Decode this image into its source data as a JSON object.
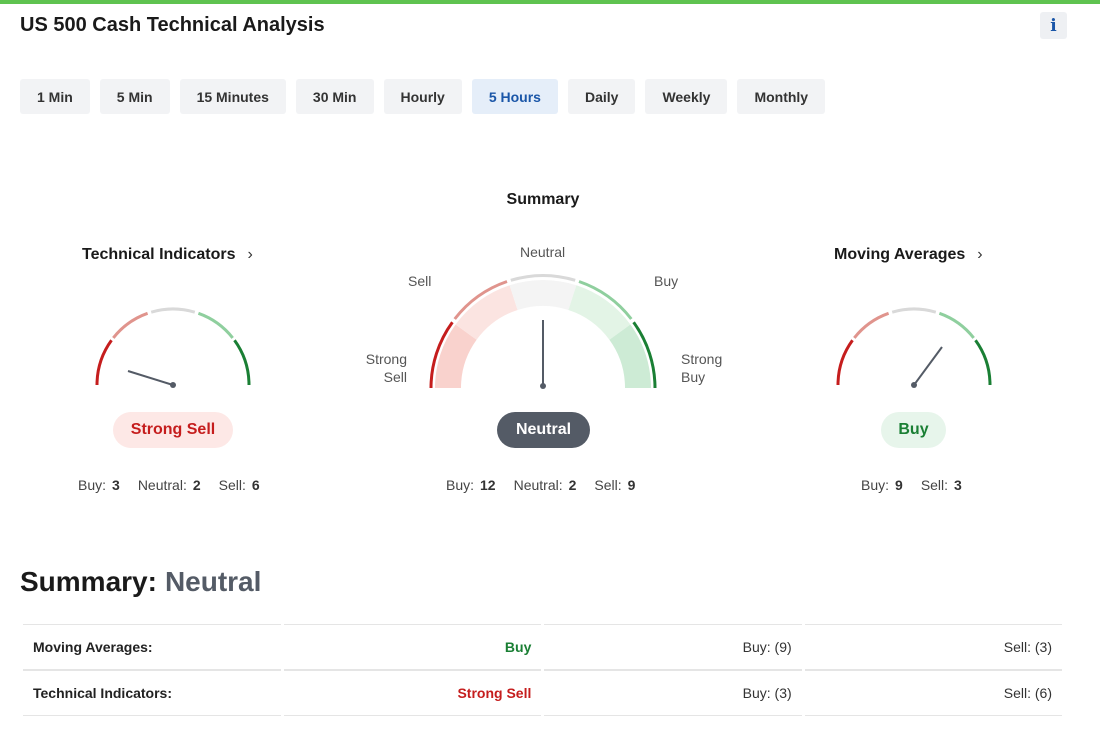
{
  "title": "US 500 Cash Technical Analysis",
  "info_label": "i",
  "timeframes": [
    "1 Min",
    "5 Min",
    "15 Minutes",
    "30 Min",
    "Hourly",
    "5 Hours",
    "Daily",
    "Weekly",
    "Monthly"
  ],
  "active_timeframe": "5 Hours",
  "summary_gauge": {
    "label": "Summary",
    "zone_labels": {
      "strong_sell": "Strong Sell",
      "sell": "Sell",
      "neutral": "Neutral",
      "buy": "Buy",
      "strong_buy": "Strong Buy"
    },
    "result": "Neutral",
    "counts": {
      "buy_label": "Buy:",
      "buy": "12",
      "neutral_label": "Neutral:",
      "neutral": "2",
      "sell_label": "Sell:",
      "sell": "9"
    }
  },
  "technical_indicators": {
    "title": "Technical Indicators",
    "result": "Strong Sell",
    "counts": {
      "buy_label": "Buy:",
      "buy": "3",
      "neutral_label": "Neutral:",
      "neutral": "2",
      "sell_label": "Sell:",
      "sell": "6"
    }
  },
  "moving_averages": {
    "title": "Moving Averages",
    "result": "Buy",
    "counts": {
      "buy_label": "Buy:",
      "buy": "9",
      "sell_label": "Sell:",
      "sell": "3"
    }
  },
  "bottom": {
    "label": "Summary:",
    "value": "Neutral",
    "rows": [
      {
        "label": "Moving Averages:",
        "signal": "Buy",
        "buy": "Buy: (9)",
        "sell": "Sell: (3)"
      },
      {
        "label": "Technical Indicators:",
        "signal": "Strong Sell",
        "buy": "Buy: (3)",
        "sell": "Sell: (6)"
      }
    ]
  },
  "colors": {
    "accent_bar": "#5fc350",
    "sell": "#c51d1d",
    "buy": "#1a7f34",
    "neutral": "#545b66",
    "active_tab": "#1a56a8"
  }
}
